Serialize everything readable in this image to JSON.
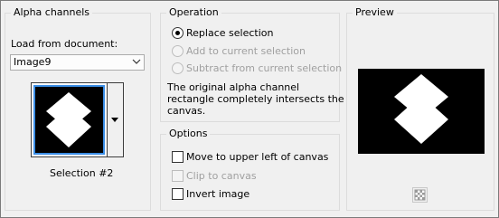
{
  "alpha_channels": {
    "title": "Alpha channels",
    "load_label": "Load from document:",
    "document_value": "Image9",
    "selection_name": "Selection #2"
  },
  "operation": {
    "title": "Operation",
    "options": [
      {
        "label": "Replace selection",
        "selected": true,
        "enabled": true
      },
      {
        "label": "Add to current selection",
        "selected": false,
        "enabled": false
      },
      {
        "label": "Subtract from current selection",
        "selected": false,
        "enabled": false
      }
    ],
    "message_line1": "The original alpha channel",
    "message_line2": "rectangle completely intersects the",
    "message_line3": "canvas."
  },
  "options": {
    "title": "Options",
    "items": [
      {
        "label": "Move to upper left of canvas",
        "checked": false,
        "enabled": true
      },
      {
        "label": "Clip to canvas",
        "checked": false,
        "enabled": false
      },
      {
        "label": "Invert image",
        "checked": false,
        "enabled": true
      }
    ]
  },
  "preview": {
    "title": "Preview"
  }
}
